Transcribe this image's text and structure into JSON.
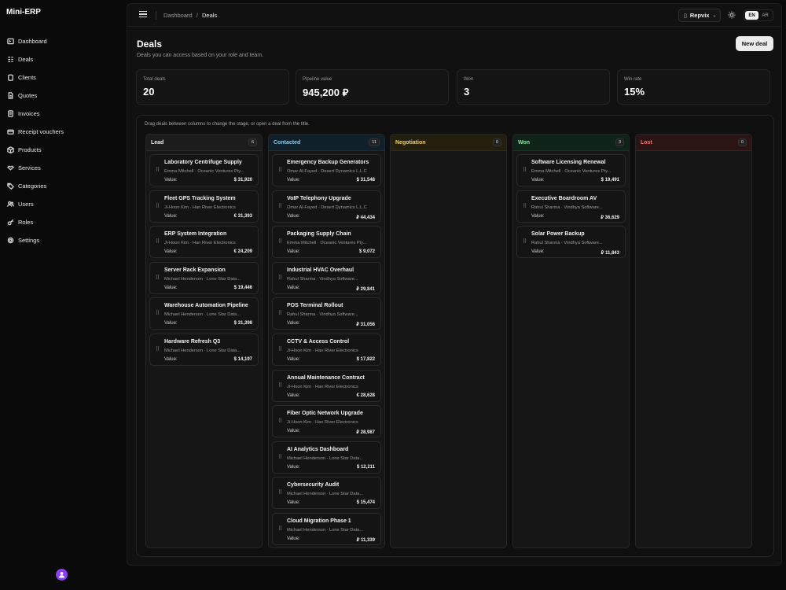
{
  "app": {
    "name": "Mini-ERP"
  },
  "sidebar": {
    "items": [
      {
        "label": "Dashboard",
        "icon": "terminal-icon"
      },
      {
        "label": "Deals",
        "icon": "kanban-icon"
      },
      {
        "label": "Clients",
        "icon": "clipboard-icon"
      },
      {
        "label": "Quotes",
        "icon": "document-icon"
      },
      {
        "label": "Invoices",
        "icon": "receipt-icon"
      },
      {
        "label": "Receipt vouchers",
        "icon": "voucher-icon"
      },
      {
        "label": "Products",
        "icon": "box-icon"
      },
      {
        "label": "Services",
        "icon": "handshake-icon"
      },
      {
        "label": "Categories",
        "icon": "tag-icon"
      },
      {
        "label": "Users",
        "icon": "users-icon"
      },
      {
        "label": "Roles",
        "icon": "key-icon"
      },
      {
        "label": "Settings",
        "icon": "gear-icon"
      }
    ]
  },
  "topbar": {
    "breadcrumb_root": "Dashboard",
    "breadcrumb_sep": "/",
    "breadcrumb_current": "Deals",
    "org": "Repvix",
    "lang_en": "EN",
    "lang_ar": "AR"
  },
  "page": {
    "title": "Deals",
    "subtitle": "Deals you can access based on your role and team.",
    "new_button": "New deal"
  },
  "stats": [
    {
      "label": "Total deals",
      "value": "20"
    },
    {
      "label": "Pipeline value",
      "value": "945,200 ⃁"
    },
    {
      "label": "Won",
      "value": "3"
    },
    {
      "label": "Win rate",
      "value": "15%"
    }
  ],
  "board": {
    "hint": "Drag deals between columns to change the stage, or open a deal from the title.",
    "value_label": "Value:",
    "columns": [
      {
        "name": "Lead",
        "count": "6",
        "color": "#eeeeee",
        "head_bg": "#1c1c1c",
        "cards": [
          {
            "title": "Laboratory Centrifuge Supply",
            "sub": "Emma Mitchell · Oceanic Ventures Pty...",
            "value": "$ 31,920"
          },
          {
            "title": "Fleet GPS Tracking System",
            "sub": "Ji-Hoon Kim · Han River Electronics",
            "value": "€ 31,393"
          },
          {
            "title": "ERP System Integration",
            "sub": "Ji-Hoon Kim · Han River Electronics",
            "value": "€ 24,209"
          },
          {
            "title": "Server Rack Expansion",
            "sub": "Michael Henderson · Lone Star Data...",
            "value": "$ 19,446"
          },
          {
            "title": "Warehouse Automation Pipeline",
            "sub": "Michael Henderson · Lone Star Data...",
            "value": "$ 31,398"
          },
          {
            "title": "Hardware Refresh Q3",
            "sub": "Michael Henderson · Lone Star Data...",
            "value": "$ 14,197"
          }
        ]
      },
      {
        "name": "Contacted",
        "count": "11",
        "color": "#8ec8ec",
        "head_bg": "#10202b",
        "cards": [
          {
            "title": "Emergency Backup Generators",
            "sub": "Omar Al-Fayed · Desert Dynamics L.L.C",
            "value": "$ 31,548"
          },
          {
            "title": "VoIP Telephony Upgrade",
            "sub": "Omar Al-Fayed · Desert Dynamics L.L.C",
            "value": "⃁ 44,434"
          },
          {
            "title": "Packaging Supply Chain",
            "sub": "Emma Mitchell · Oceanic Ventures Pty...",
            "value": "$ 9,072"
          },
          {
            "title": "Industrial HVAC Overhaul",
            "sub": "Rahul Sharma · Vindhya Software...",
            "value": "⃁ 29,841"
          },
          {
            "title": "POS Terminal Rollout",
            "sub": "Rahul Sharma · Vindhya Software...",
            "value": "⃁ 31,056"
          },
          {
            "title": "CCTV & Access Control",
            "sub": "Ji-Hoon Kim · Han River Electronics",
            "value": "$ 17,822"
          },
          {
            "title": "Annual Maintenance Contract",
            "sub": "Ji-Hoon Kim · Han River Electronics",
            "value": "€ 28,628"
          },
          {
            "title": "Fiber Optic Network Upgrade",
            "sub": "Ji-Hoon Kim · Han River Electronics",
            "value": "⃁ 28,987"
          },
          {
            "title": "AI Analytics Dashboard",
            "sub": "Michael Henderson · Lone Star Data...",
            "value": "$ 12,211"
          },
          {
            "title": "Cybersecurity Audit",
            "sub": "Michael Henderson · Lone Star Data...",
            "value": "$ 15,474"
          },
          {
            "title": "Cloud Migration Phase 1",
            "sub": "Michael Henderson · Lone Star Data...",
            "value": "⃁ 11,339"
          }
        ]
      },
      {
        "name": "Negotiation",
        "count": "0",
        "color": "#f0d060",
        "head_bg": "#241e0c",
        "cards": []
      },
      {
        "name": "Won",
        "count": "3",
        "color": "#86e3a4",
        "head_bg": "#0e2419",
        "cards": [
          {
            "title": "Software Licensing Renewal",
            "sub": "Emma Mitchell · Oceanic Ventures Pty...",
            "value": "$ 19,491"
          },
          {
            "title": "Executive Boardroom AV",
            "sub": "Rahul Sharma · Vindhya Software...",
            "value": "⃁ 36,629"
          },
          {
            "title": "Solar Power Backup",
            "sub": "Rahul Sharma · Vindhya Software...",
            "value": "⃁ 11,843"
          }
        ]
      },
      {
        "name": "Lost",
        "count": "0",
        "color": "#f07a7a",
        "head_bg": "#2a1414",
        "cards": []
      }
    ]
  }
}
